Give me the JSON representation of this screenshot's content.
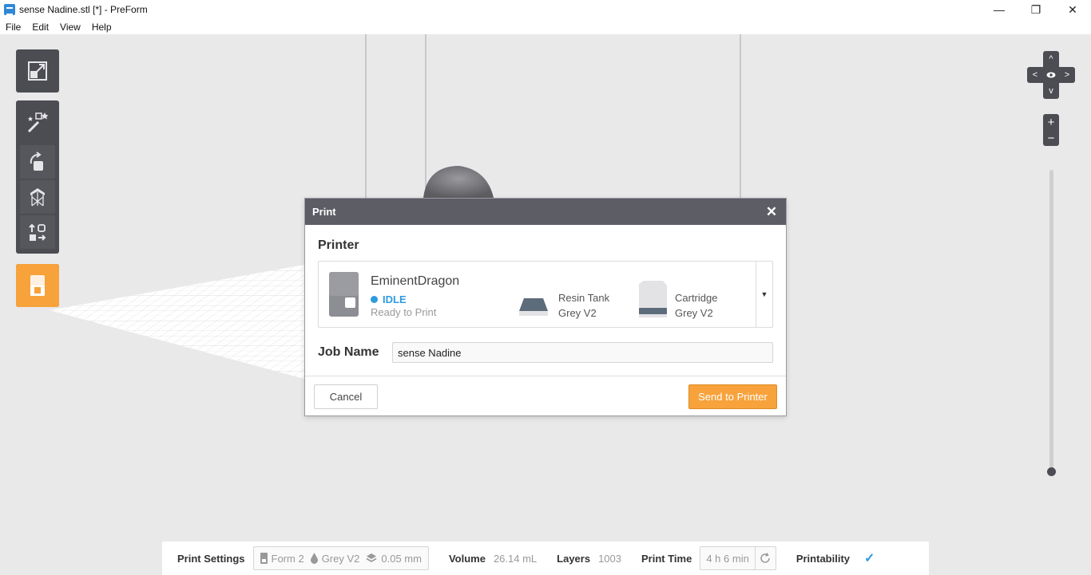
{
  "window": {
    "title": "sense Nadine.stl [*] - PreForm",
    "minimize_glyph": "—",
    "maximize_glyph": "❐",
    "close_glyph": "✕"
  },
  "menu": {
    "items": [
      "File",
      "Edit",
      "View",
      "Help"
    ]
  },
  "toolbar": {
    "icons": [
      "fit-view-icon",
      "magic-wand-icon",
      "orientation-icon",
      "supports-icon",
      "layout-icon",
      "print-icon"
    ],
    "active_color": "#f7a23b"
  },
  "nav": {
    "up": "^",
    "down": "v",
    "left": "<",
    "right": ">",
    "zoom_in": "+",
    "zoom_out": "−"
  },
  "dialog": {
    "title": "Print",
    "close_glyph": "✕",
    "printer_section_title": "Printer",
    "printer": {
      "name": "EminentDragon",
      "status": "IDLE",
      "status_color": "#2d9be0",
      "substatus": "Ready to Print",
      "resin_tank_label": "Resin Tank",
      "resin_tank_value": "Grey V2",
      "cartridge_label": "Cartridge",
      "cartridge_value": "Grey V2",
      "dropdown_glyph": "▼"
    },
    "job_name_label": "Job Name",
    "job_name_value": "sense Nadine",
    "cancel_label": "Cancel",
    "send_label": "Send to Printer"
  },
  "statusbar": {
    "print_settings_label": "Print Settings",
    "printer_model": "Form 2",
    "material": "Grey V2",
    "layer_height": "0.05 mm",
    "volume_label": "Volume",
    "volume_value": "26.14 mL",
    "layers_label": "Layers",
    "layers_value": "1003",
    "print_time_label": "Print Time",
    "print_time_value": "4 h 6 min",
    "printability_label": "Printability",
    "check_glyph": "✓"
  }
}
